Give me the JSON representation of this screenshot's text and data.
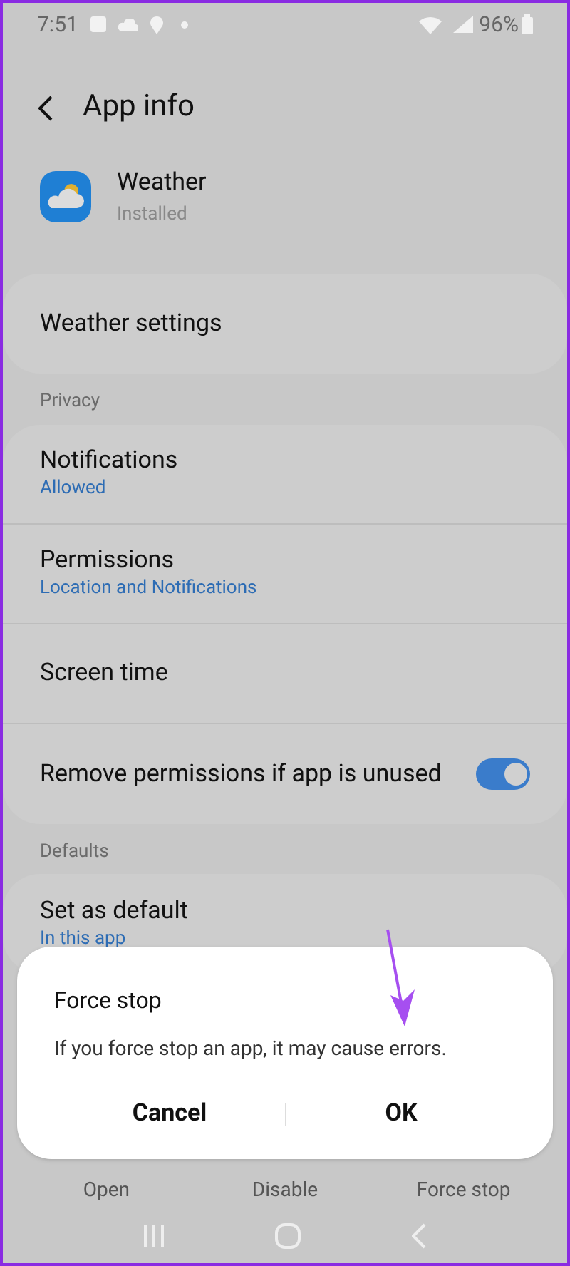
{
  "status_bar": {
    "time": "7:51",
    "battery": "96%"
  },
  "header": {
    "title": "App info"
  },
  "app": {
    "name": "Weather",
    "status": "Installed"
  },
  "sections": [
    {
      "items": [
        {
          "kind": "link",
          "title": "Weather settings"
        }
      ]
    },
    {
      "heading": "Privacy",
      "items": [
        {
          "kind": "link",
          "title": "Notifications",
          "subtitle": "Allowed"
        },
        {
          "kind": "link",
          "title": "Permissions",
          "subtitle": "Location and Notifications"
        },
        {
          "kind": "link",
          "title": "Screen time"
        },
        {
          "kind": "toggle",
          "title": "Remove permissions if app is unused",
          "on": true
        }
      ]
    },
    {
      "heading": "Defaults",
      "items": [
        {
          "kind": "link",
          "title": "Set as default",
          "subtitle": "In this app"
        }
      ]
    }
  ],
  "bottom_actions": [
    "Open",
    "Disable",
    "Force stop"
  ],
  "dialog": {
    "title": "Force stop",
    "message": "If you force stop an app, it may cause errors.",
    "buttons": [
      "Cancel",
      "OK"
    ]
  }
}
